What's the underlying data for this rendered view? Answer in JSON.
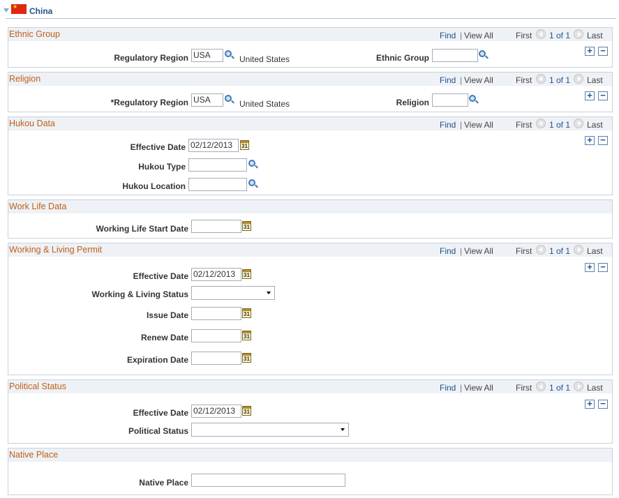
{
  "page": {
    "title": "China"
  },
  "nav": {
    "find": "Find",
    "separator": "|",
    "view_all": "View All",
    "first": "First",
    "count": "1 of 1",
    "last": "Last",
    "add": "+",
    "remove": "−"
  },
  "sections": {
    "ethnic": {
      "title": "Ethnic Group",
      "regulatory_region_label": "Regulatory Region",
      "regulatory_region_value": "USA",
      "regulatory_region_desc": "United States",
      "ethnic_group_label": "Ethnic Group",
      "ethnic_group_value": ""
    },
    "religion": {
      "title": "Religion",
      "regulatory_region_label": "*Regulatory Region",
      "regulatory_region_value": "USA",
      "regulatory_region_desc": "United States",
      "religion_label": "Religion",
      "religion_value": ""
    },
    "hukou": {
      "title": "Hukou Data",
      "effective_date_label": "Effective Date",
      "effective_date_value": "02/12/2013",
      "hukou_type_label": "Hukou Type",
      "hukou_type_value": "",
      "hukou_location_label": "Hukou Location",
      "hukou_location_value": ""
    },
    "worklife": {
      "title": "Work Life Data",
      "start_date_label": "Working Life Start Date",
      "start_date_value": ""
    },
    "permit": {
      "title": "Working & Living Permit",
      "effective_date_label": "Effective Date",
      "effective_date_value": "02/12/2013",
      "status_label": "Working & Living Status",
      "status_value": "",
      "issue_date_label": "Issue Date",
      "issue_date_value": "",
      "renew_date_label": "Renew Date",
      "renew_date_value": "",
      "expiration_date_label": "Expiration Date",
      "expiration_date_value": ""
    },
    "political": {
      "title": "Political Status",
      "effective_date_label": "Effective Date",
      "effective_date_value": "02/12/2013",
      "status_label": "Political Status",
      "status_value": ""
    },
    "native": {
      "title": "Native Place",
      "native_place_label": "Native Place",
      "native_place_value": ""
    }
  },
  "icons": {
    "lookup": "lookup-icon",
    "calendar": "calendar-icon",
    "calendar_day": "31",
    "flag": "china-flag-icon",
    "flag_star": "★"
  },
  "colors": {
    "section_title": "#c05f19",
    "link": "#1f5390",
    "header_bg": "#eef1f5",
    "border": "#c9d2dc",
    "flag_red": "#de2910"
  }
}
